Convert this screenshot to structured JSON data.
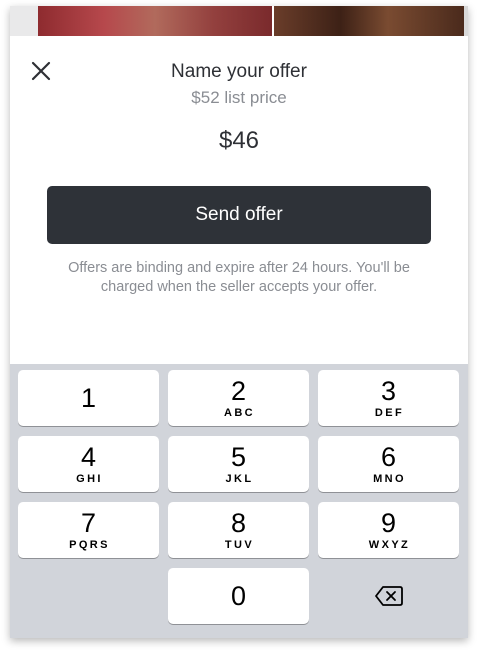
{
  "sheet": {
    "title": "Name your offer",
    "subtitle": "$52 list price",
    "offer_value": "$46",
    "send_label": "Send offer",
    "disclaimer": "Offers are binding and expire after 24 hours. You'll be charged when the seller accepts your offer."
  },
  "icons": {
    "close": "close-icon",
    "backspace": "backspace-icon"
  },
  "keypad": {
    "keys": [
      {
        "digit": "1",
        "letters": ""
      },
      {
        "digit": "2",
        "letters": "ABC"
      },
      {
        "digit": "3",
        "letters": "DEF"
      },
      {
        "digit": "4",
        "letters": "GHI"
      },
      {
        "digit": "5",
        "letters": "JKL"
      },
      {
        "digit": "6",
        "letters": "MNO"
      },
      {
        "digit": "7",
        "letters": "PQRS"
      },
      {
        "digit": "8",
        "letters": "TUV"
      },
      {
        "digit": "9",
        "letters": "WXYZ"
      },
      {
        "digit": "0",
        "letters": ""
      }
    ]
  },
  "colors": {
    "button_bg": "#2e3238",
    "keyboard_bg": "#d1d4da",
    "text_primary": "#2e3035",
    "text_secondary": "#8a8d93"
  }
}
